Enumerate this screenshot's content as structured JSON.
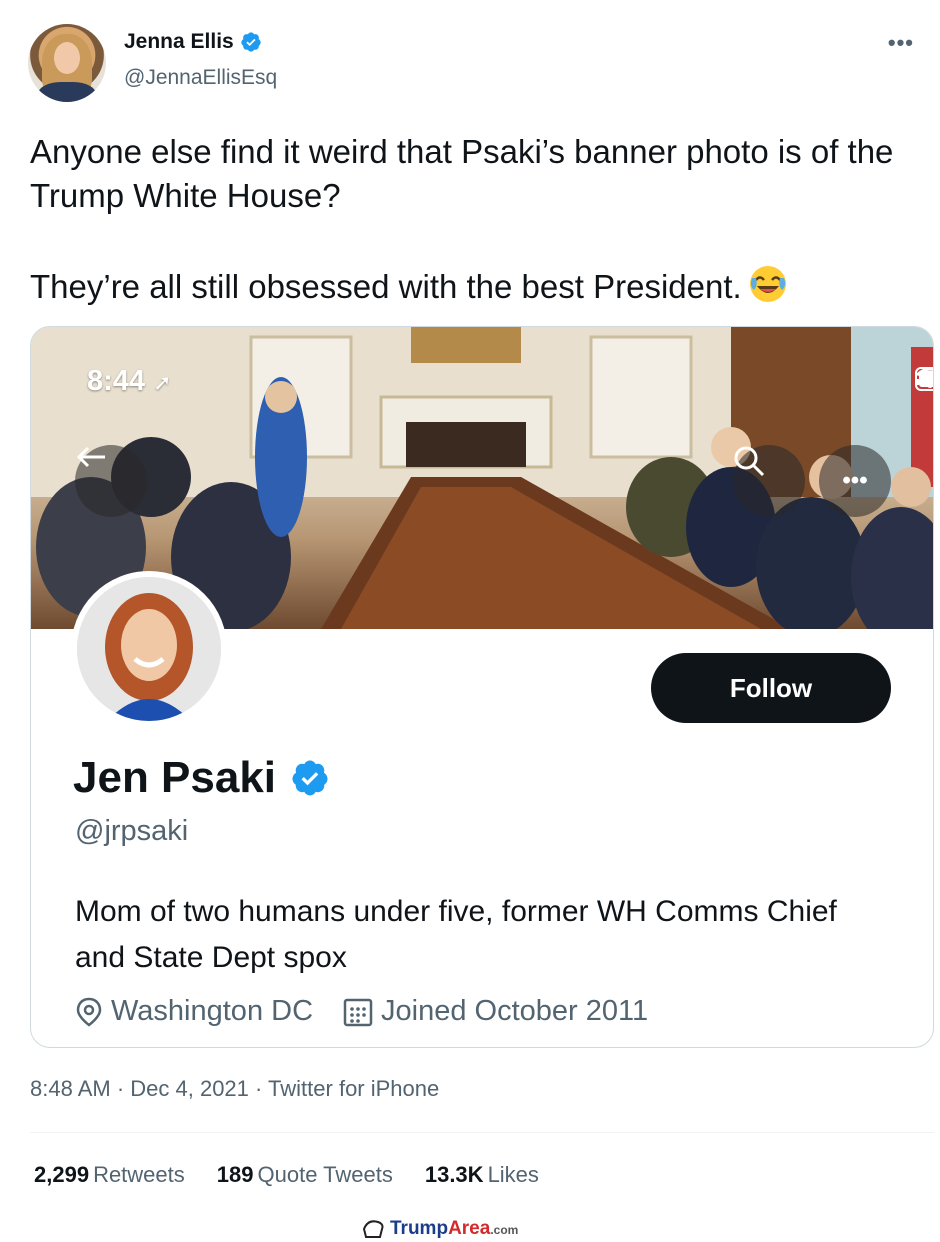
{
  "tweet": {
    "author_name": "Jenna Ellis",
    "author_handle": "@JennaEllisEsq",
    "more_label": "•••",
    "text_line1": "Anyone else find it weird that Psaki’s banner photo is of the Trump White House?",
    "text_line2": "They’re all still obsessed with the best President.",
    "emoji": "face-with-tears-of-joy",
    "timestamp": "8:48 AM · Dec 4, 2021 · Twitter for iPhone",
    "stats": {
      "retweets_count": "2,299",
      "retweets_label": "Retweets",
      "quotes_count": "189",
      "quotes_label": "Quote Tweets",
      "likes_count": "13.3K",
      "likes_label": "Likes"
    }
  },
  "embedded_profile": {
    "status_time": "8:44",
    "name": "Jen Psaki",
    "handle": "@jrpsaki",
    "bio": "Mom of two humans under five, former WH Comms Chief and State Dept spox",
    "location": "Washington DC",
    "joined": "Joined October 2011",
    "follow_label": "Follow"
  },
  "watermark": {
    "brand_part1": "Trump",
    "brand_part2": "Area",
    "brand_suffix": ".com"
  },
  "colors": {
    "verified_blue": "#1d9bf0",
    "text_primary": "#0f1419",
    "text_secondary": "#536471",
    "follow_bg": "#0f1419"
  }
}
